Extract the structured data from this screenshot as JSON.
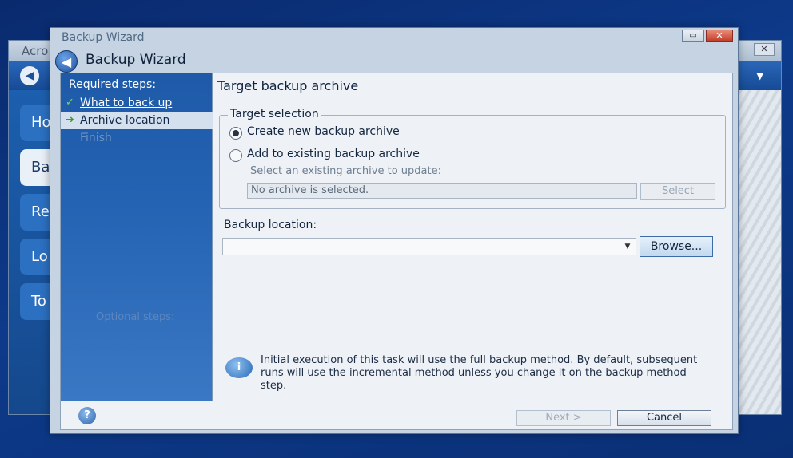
{
  "background_app": {
    "title": "Acro",
    "close_label": "✕",
    "back_glyph": "◀",
    "dropdown_glyph": "▼",
    "sidebar": [
      {
        "label": "Ho",
        "active": false
      },
      {
        "label": "Ba",
        "active": true
      },
      {
        "label": "Re",
        "active": false
      },
      {
        "label": "Lo",
        "active": false
      },
      {
        "label": "To",
        "active": false
      }
    ]
  },
  "wizard": {
    "window_title": "Backup Wizard",
    "heading": "Backup Wizard",
    "minimize_label": "▭",
    "close_label": "✕",
    "back_glyph": "◀",
    "steps": {
      "required_heading": "Required steps:",
      "items": [
        {
          "label": "What to back up",
          "mark": "✓",
          "state": "done"
        },
        {
          "label": "Archive location",
          "mark": "➔",
          "state": "current"
        },
        {
          "label": "Finish",
          "mark": "",
          "state": "pending"
        }
      ],
      "optional_heading": "Optional steps:"
    },
    "help_glyph": "?",
    "content": {
      "title": "Target backup archive",
      "target_selection": {
        "legend": "Target selection",
        "option_new": "Create new backup archive",
        "option_existing": "Add to existing backup archive",
        "selected": "new",
        "existing_prompt": "Select an existing archive to update:",
        "archive_field_value": "No archive is selected.",
        "select_button": "Select"
      },
      "backup_location": {
        "label": "Backup location:",
        "value": "",
        "browse_button": "Browse..."
      },
      "info_text": "Initial execution of this task will use the full backup method. By default, subsequent runs will use the incremental method unless you change it on the backup method step."
    },
    "buttons": {
      "next": "Next >",
      "cancel": "Cancel"
    }
  },
  "colors": {
    "desktop": "#0d3a8a",
    "steps_panel": "#1e5aa8",
    "close_red": "#c03a24"
  }
}
